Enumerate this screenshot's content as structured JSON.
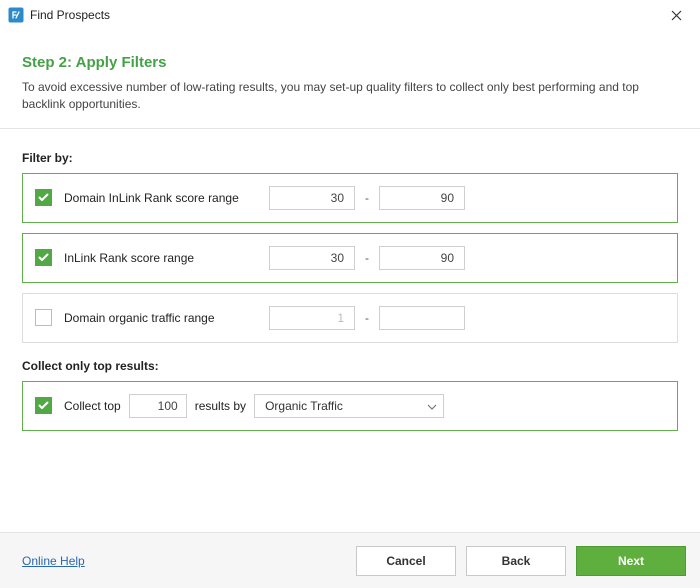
{
  "window": {
    "title": "Find Prospects"
  },
  "header": {
    "step_title": "Step 2: Apply Filters",
    "description": "To avoid excessive number of low-rating results, you may set-up quality filters to collect only best performing and top backlink opportunities."
  },
  "filters_section": {
    "label": "Filter by:",
    "rows": [
      {
        "checked": true,
        "label": "Domain InLink Rank score range",
        "from": "30",
        "to": "90"
      },
      {
        "checked": true,
        "label": "InLink Rank score range",
        "from": "30",
        "to": "90"
      },
      {
        "checked": false,
        "label": "Domain organic traffic range",
        "from": "1",
        "to": ""
      }
    ]
  },
  "collect_section": {
    "label": "Collect only top results:",
    "checked": true,
    "prefix": "Collect top",
    "count": "100",
    "middle": "results by",
    "dropdown_value": "Organic Traffic"
  },
  "footer": {
    "help": "Online Help",
    "cancel": "Cancel",
    "back": "Back",
    "next": "Next"
  }
}
